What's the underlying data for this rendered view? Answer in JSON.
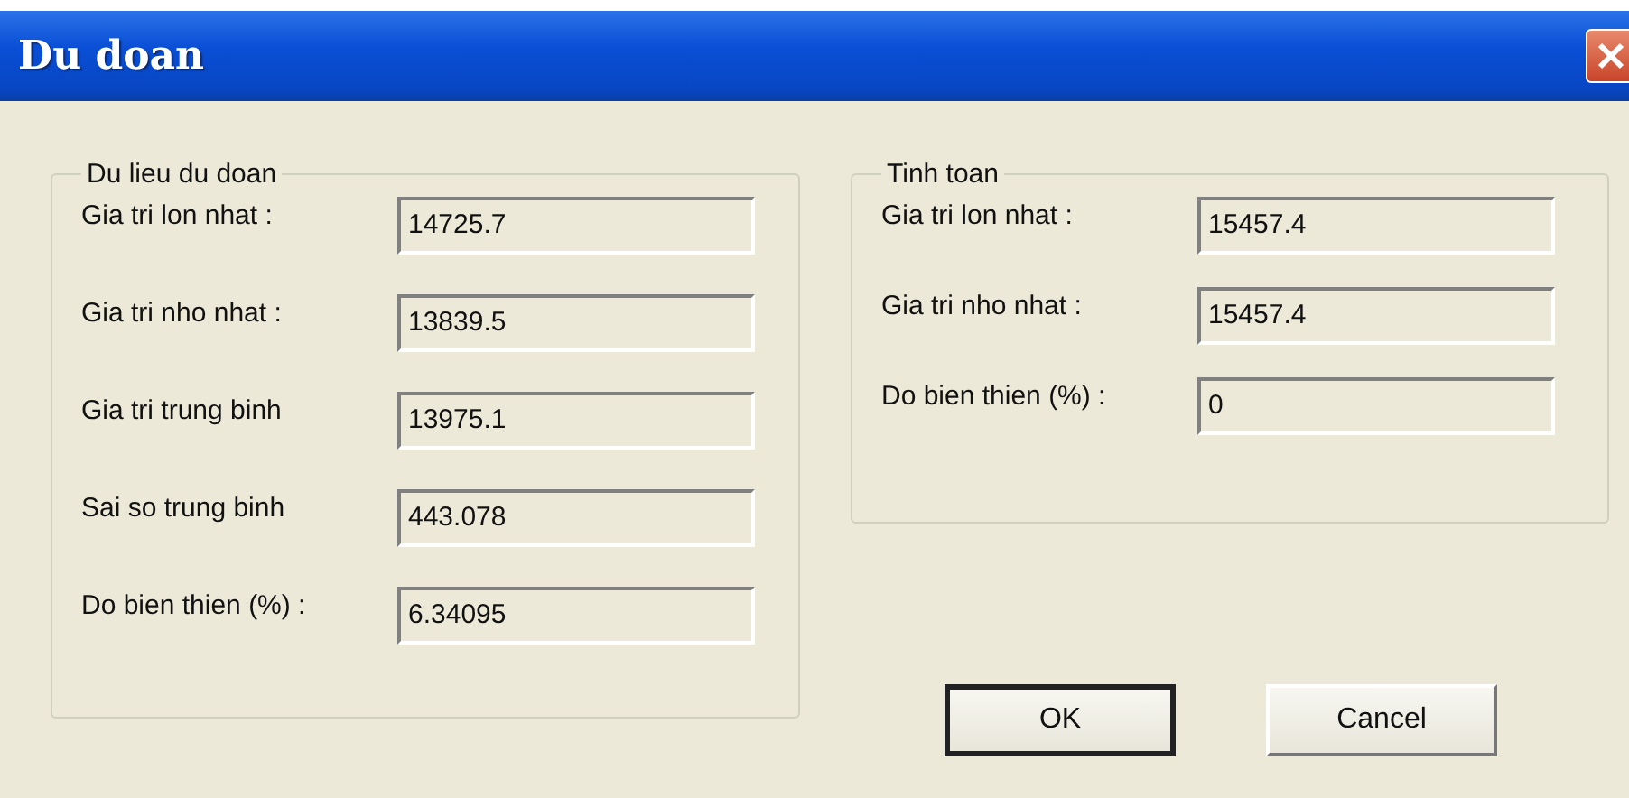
{
  "window": {
    "title": "Du doan"
  },
  "groups": [
    {
      "title": "Du lieu du doan",
      "fields": [
        {
          "label": "Gia tri lon nhat :",
          "value": "14725.7"
        },
        {
          "label": "Gia tri nho nhat :",
          "value": "13839.5"
        },
        {
          "label": "Gia tri trung binh",
          "value": "13975.1"
        },
        {
          "label": "Sai so trung binh",
          "value": "443.078"
        },
        {
          "label": "Do bien thien (%) :",
          "value": "6.34095"
        }
      ]
    },
    {
      "title": "Tinh toan",
      "fields": [
        {
          "label": "Gia tri lon nhat :",
          "value": "15457.4"
        },
        {
          "label": "Gia tri nho nhat :",
          "value": "15457.4"
        },
        {
          "label": "Do bien thien (%) :",
          "value": "0"
        }
      ]
    }
  ],
  "buttons": [
    {
      "label": "OK",
      "default": true
    },
    {
      "label": "Cancel",
      "default": false
    }
  ]
}
